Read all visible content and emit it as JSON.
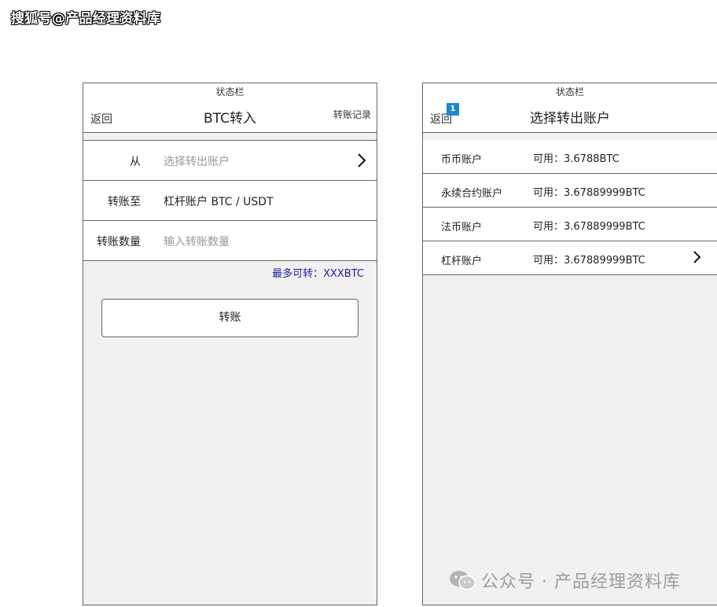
{
  "watermarks": {
    "top": "搜狐号@产品经理资料库",
    "bottom": "公众号 · 产品经理资料库"
  },
  "left_screen": {
    "status_bar": "状态栏",
    "back": "返回",
    "title": "BTC转入",
    "right_action": "转账记录",
    "rows": [
      {
        "label": "从",
        "placeholder": "选择转出账户"
      },
      {
        "label": "转账至",
        "value": "杠杆账户 BTC / USDT"
      },
      {
        "label": "转账数量",
        "placeholder": "输入转账数量"
      }
    ],
    "max_hint": "最多可转：XXXBTC",
    "submit": "转账"
  },
  "right_screen": {
    "status_bar": "状态栏",
    "back": "返回",
    "badge": "1",
    "title": "选择转出账户",
    "accounts": [
      {
        "name": "币币账户",
        "balance": "可用：3.6788BTC"
      },
      {
        "name": "永续合约账户",
        "balance": "可用：3.67889999BTC"
      },
      {
        "name": "法币账户",
        "balance": "可用：3.67889999BTC"
      },
      {
        "name": "杠杆账户",
        "balance": "可用：3.67889999BTC"
      }
    ]
  },
  "icons": {
    "chevron": "chevron-right-icon",
    "wechat": "wechat-icon"
  },
  "colors": {
    "accent_text": "#1a1aa6",
    "badge": "#1e88c8",
    "panel_bg": "#f1f1f1"
  }
}
